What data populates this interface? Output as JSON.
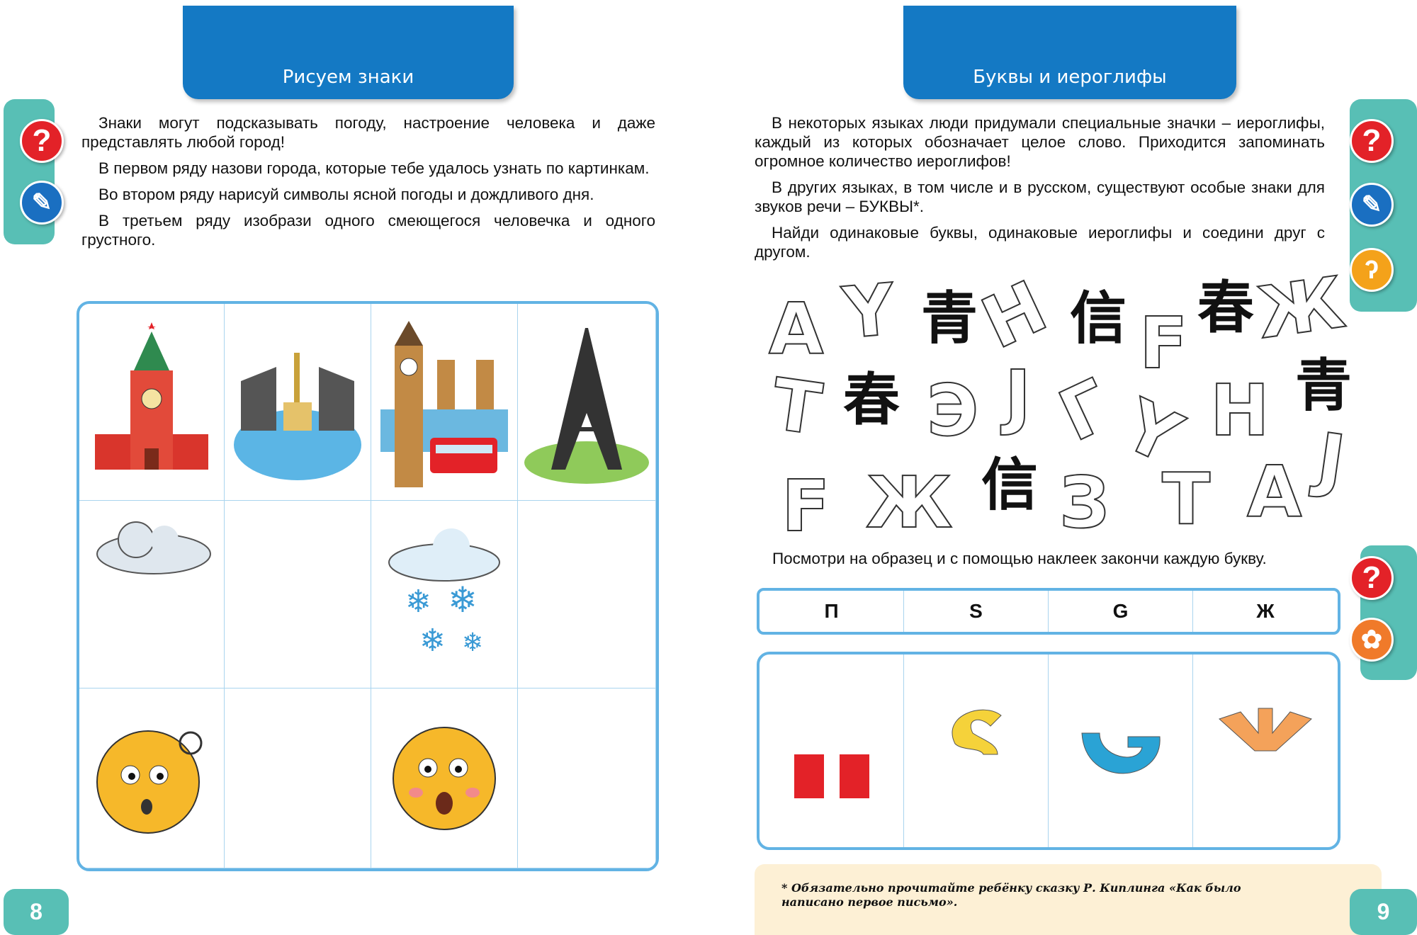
{
  "left_page": {
    "title": "Рисуем знаки",
    "paragraphs": [
      "Знаки могут подсказывать погоду, настроение человека и даже представлять любой город!",
      "В первом ряду назови города, которые тебе удалось узнать по картинкам.",
      "Во втором ряду нарисуй символы ясной погоды и дождливого дня.",
      "В третьем ряду изобрази одного смеющегося человечка и одного грустного."
    ],
    "page_number": "8",
    "grid_images": [
      "kremlin-tower",
      "drawbridge-spb",
      "big-ben-london",
      "eiffel-tower",
      "cloud",
      "empty",
      "snow-cloud",
      "empty",
      "surprised-face",
      "empty",
      "shocked-face",
      "empty"
    ]
  },
  "right_page": {
    "title": "Буквы и иероглифы",
    "paragraphs": [
      "В некоторых языках люди придумали специальные значки – иероглифы, каждый из которых обозначает целое слово. Приходится запоминать огромное количество иероглифов!",
      "В других языках, в том числе и в русском, существуют особые знаки для звуков речи – БУКВЫ*.",
      "Найди одинаковые буквы, одинаковые иероглифы и соедини друг с другом."
    ],
    "letters": [
      "A",
      "Y",
      "青",
      "H",
      "信",
      "F",
      "春",
      "Ж",
      "T",
      "春",
      "Э",
      "J",
      "Г",
      "Y",
      "H",
      "青",
      "F",
      "Ж",
      "信",
      "З",
      "T",
      "A",
      "J"
    ],
    "instruction": "Посмотри на образец и с помощью наклеек закончи каждую букву.",
    "sample_letters": [
      "П",
      "S",
      "G",
      "Ж"
    ],
    "footnote": "* Обязательно прочитайте ребёнку сказку Р. Киплинга «Как было написано первое письмо».",
    "page_number": "9"
  },
  "icons": {
    "question": "?",
    "pencil": "pencil-icon",
    "hook": "hook-icon",
    "flower": "flower-icon"
  },
  "colors": {
    "banner": "#1479c4",
    "tab": "#58bfb5",
    "grid_border": "#62b3e4",
    "footnote_bg": "#fdf0d5"
  }
}
